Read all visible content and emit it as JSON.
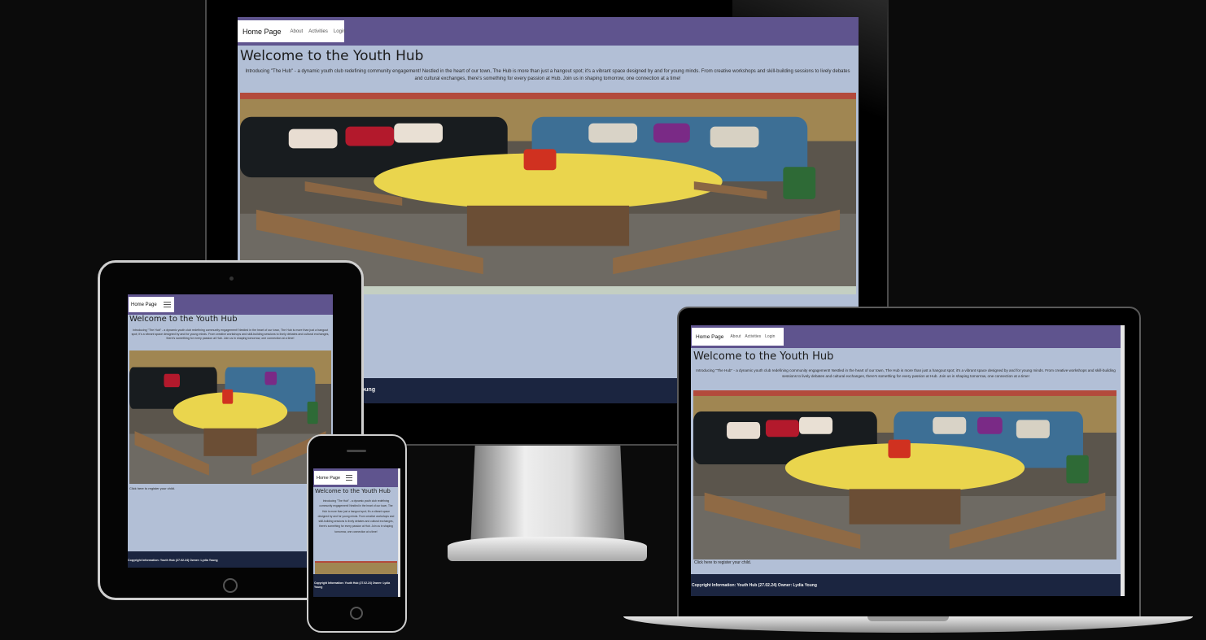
{
  "site": {
    "brand": "Home Page",
    "nav": [
      "About",
      "Activities",
      "Login"
    ],
    "heading": "Welcome to the Youth Hub",
    "intro": "Introducing \"The Hub\" - a dynamic youth club redefining community engagement! Nestled in the heart of our town, The Hub is more than just a hangout spot; it's a vibrant space designed by and for young minds. From creative workshops and skill-building sessions to lively debates and cultural exchanges, there's something for every passion at Hub. Join us in shaping tomorrow, one connection at a time!",
    "register_text": "Click here to register your child.",
    "footer_text": "Copyright Information: Youth Hub (27.02.24) Owner: Lydia Young",
    "footer_fragment": "oung"
  },
  "icons": {
    "menu": "hamburger-menu-icon"
  },
  "colors": {
    "page_background": "#0b0b0b",
    "navbar": "#5f548e",
    "body": "#b2bfd6",
    "footer": "#1b2540",
    "nav_box": "#ffffff"
  }
}
